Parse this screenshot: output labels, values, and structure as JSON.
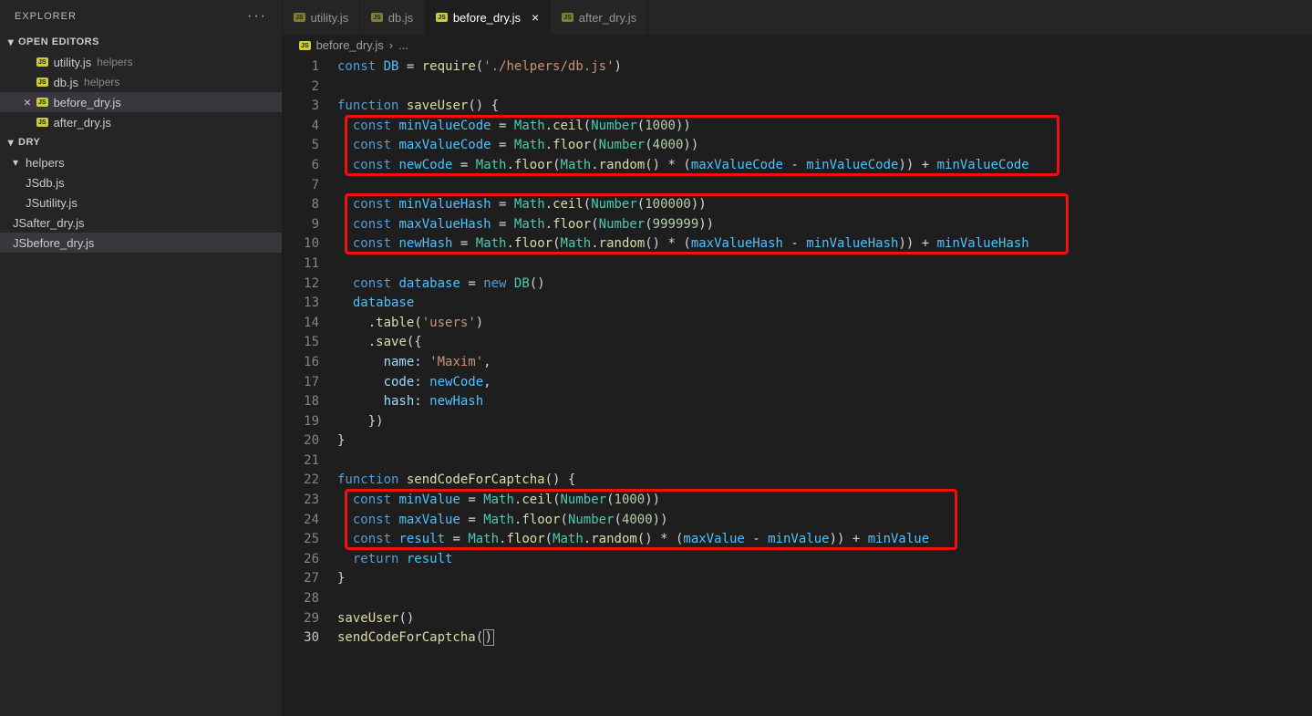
{
  "sidebar": {
    "title": "EXPLORER",
    "sections": {
      "open_editors": {
        "label": "OPEN EDITORS",
        "items": [
          {
            "name": "utility.js",
            "path": "helpers",
            "active": false,
            "showClose": false
          },
          {
            "name": "db.js",
            "path": "helpers",
            "active": false,
            "showClose": false
          },
          {
            "name": "before_dry.js",
            "path": "",
            "active": true,
            "showClose": true
          },
          {
            "name": "after_dry.js",
            "path": "",
            "active": false,
            "showClose": false
          }
        ]
      },
      "project": {
        "label": "DRY",
        "tree": [
          {
            "type": "folder",
            "name": "helpers",
            "depth": 1
          },
          {
            "type": "file",
            "name": "db.js",
            "depth": 2
          },
          {
            "type": "file",
            "name": "utility.js",
            "depth": 2
          },
          {
            "type": "file",
            "name": "after_dry.js",
            "depth": 1
          },
          {
            "type": "file",
            "name": "before_dry.js",
            "depth": 1,
            "active": true
          }
        ]
      }
    }
  },
  "tabs": [
    {
      "name": "utility.js",
      "active": false
    },
    {
      "name": "db.js",
      "active": false
    },
    {
      "name": "before_dry.js",
      "active": true
    },
    {
      "name": "after_dry.js",
      "active": false
    }
  ],
  "breadcrumb": {
    "file": "before_dry.js",
    "sep": "›",
    "more": "..."
  },
  "code": {
    "lines": [
      [
        [
          "kw",
          "const"
        ],
        [
          "plain",
          " "
        ],
        [
          "const",
          "DB"
        ],
        [
          "plain",
          " = "
        ],
        [
          "fn",
          "require"
        ],
        [
          "plain",
          "("
        ],
        [
          "str",
          "'./helpers/db.js'"
        ],
        [
          "plain",
          ")"
        ]
      ],
      [],
      [
        [
          "kw",
          "function"
        ],
        [
          "plain",
          " "
        ],
        [
          "fn",
          "saveUser"
        ],
        [
          "plain",
          "() {"
        ]
      ],
      [
        [
          "plain",
          "  "
        ],
        [
          "kw",
          "const"
        ],
        [
          "plain",
          " "
        ],
        [
          "const",
          "minValueCode"
        ],
        [
          "plain",
          " = "
        ],
        [
          "type",
          "Math"
        ],
        [
          "plain",
          "."
        ],
        [
          "fn",
          "ceil"
        ],
        [
          "plain",
          "("
        ],
        [
          "type",
          "Number"
        ],
        [
          "plain",
          "("
        ],
        [
          "num",
          "1000"
        ],
        [
          "plain",
          "))"
        ]
      ],
      [
        [
          "plain",
          "  "
        ],
        [
          "kw",
          "const"
        ],
        [
          "plain",
          " "
        ],
        [
          "const",
          "maxValueCode"
        ],
        [
          "plain",
          " = "
        ],
        [
          "type",
          "Math"
        ],
        [
          "plain",
          "."
        ],
        [
          "fn",
          "floor"
        ],
        [
          "plain",
          "("
        ],
        [
          "type",
          "Number"
        ],
        [
          "plain",
          "("
        ],
        [
          "num",
          "4000"
        ],
        [
          "plain",
          "))"
        ]
      ],
      [
        [
          "plain",
          "  "
        ],
        [
          "kw",
          "const"
        ],
        [
          "plain",
          " "
        ],
        [
          "const",
          "newCode"
        ],
        [
          "plain",
          " = "
        ],
        [
          "type",
          "Math"
        ],
        [
          "plain",
          "."
        ],
        [
          "fn",
          "floor"
        ],
        [
          "plain",
          "("
        ],
        [
          "type",
          "Math"
        ],
        [
          "plain",
          "."
        ],
        [
          "fn",
          "random"
        ],
        [
          "plain",
          "() * ("
        ],
        [
          "const",
          "maxValueCode"
        ],
        [
          "plain",
          " - "
        ],
        [
          "const",
          "minValueCode"
        ],
        [
          "plain",
          ")) + "
        ],
        [
          "const",
          "minValueCode"
        ]
      ],
      [],
      [
        [
          "plain",
          "  "
        ],
        [
          "kw",
          "const"
        ],
        [
          "plain",
          " "
        ],
        [
          "const",
          "minValueHash"
        ],
        [
          "plain",
          " = "
        ],
        [
          "type",
          "Math"
        ],
        [
          "plain",
          "."
        ],
        [
          "fn",
          "ceil"
        ],
        [
          "plain",
          "("
        ],
        [
          "type",
          "Number"
        ],
        [
          "plain",
          "("
        ],
        [
          "num",
          "100000"
        ],
        [
          "plain",
          "))"
        ]
      ],
      [
        [
          "plain",
          "  "
        ],
        [
          "kw",
          "const"
        ],
        [
          "plain",
          " "
        ],
        [
          "const",
          "maxValueHash"
        ],
        [
          "plain",
          " = "
        ],
        [
          "type",
          "Math"
        ],
        [
          "plain",
          "."
        ],
        [
          "fn",
          "floor"
        ],
        [
          "plain",
          "("
        ],
        [
          "type",
          "Number"
        ],
        [
          "plain",
          "("
        ],
        [
          "num",
          "999999"
        ],
        [
          "plain",
          "))"
        ]
      ],
      [
        [
          "plain",
          "  "
        ],
        [
          "kw",
          "const"
        ],
        [
          "plain",
          " "
        ],
        [
          "const",
          "newHash"
        ],
        [
          "plain",
          " = "
        ],
        [
          "type",
          "Math"
        ],
        [
          "plain",
          "."
        ],
        [
          "fn",
          "floor"
        ],
        [
          "plain",
          "("
        ],
        [
          "type",
          "Math"
        ],
        [
          "plain",
          "."
        ],
        [
          "fn",
          "random"
        ],
        [
          "plain",
          "() * ("
        ],
        [
          "const",
          "maxValueHash"
        ],
        [
          "plain",
          " - "
        ],
        [
          "const",
          "minValueHash"
        ],
        [
          "plain",
          ")) + "
        ],
        [
          "const",
          "minValueHash"
        ]
      ],
      [],
      [
        [
          "plain",
          "  "
        ],
        [
          "kw",
          "const"
        ],
        [
          "plain",
          " "
        ],
        [
          "const",
          "database"
        ],
        [
          "plain",
          " = "
        ],
        [
          "kw",
          "new"
        ],
        [
          "plain",
          " "
        ],
        [
          "type",
          "DB"
        ],
        [
          "plain",
          "()"
        ]
      ],
      [
        [
          "plain",
          "  "
        ],
        [
          "const",
          "database"
        ]
      ],
      [
        [
          "plain",
          "    ."
        ],
        [
          "fn",
          "table"
        ],
        [
          "plain",
          "("
        ],
        [
          "str",
          "'users'"
        ],
        [
          "plain",
          ")"
        ]
      ],
      [
        [
          "plain",
          "    ."
        ],
        [
          "fn",
          "save"
        ],
        [
          "plain",
          "({"
        ]
      ],
      [
        [
          "plain",
          "      "
        ],
        [
          "prop",
          "name"
        ],
        [
          "plain",
          ": "
        ],
        [
          "str",
          "'Maxim'"
        ],
        [
          "plain",
          ","
        ]
      ],
      [
        [
          "plain",
          "      "
        ],
        [
          "prop",
          "code"
        ],
        [
          "plain",
          ": "
        ],
        [
          "const",
          "newCode"
        ],
        [
          "plain",
          ","
        ]
      ],
      [
        [
          "plain",
          "      "
        ],
        [
          "prop",
          "hash"
        ],
        [
          "plain",
          ": "
        ],
        [
          "const",
          "newHash"
        ]
      ],
      [
        [
          "plain",
          "    })"
        ]
      ],
      [
        [
          "plain",
          "}"
        ]
      ],
      [],
      [
        [
          "kw",
          "function"
        ],
        [
          "plain",
          " "
        ],
        [
          "fn",
          "sendCodeForCaptcha"
        ],
        [
          "plain",
          "() {"
        ]
      ],
      [
        [
          "plain",
          "  "
        ],
        [
          "kw",
          "const"
        ],
        [
          "plain",
          " "
        ],
        [
          "const",
          "minValue"
        ],
        [
          "plain",
          " = "
        ],
        [
          "type",
          "Math"
        ],
        [
          "plain",
          "."
        ],
        [
          "fn",
          "ceil"
        ],
        [
          "plain",
          "("
        ],
        [
          "type",
          "Number"
        ],
        [
          "plain",
          "("
        ],
        [
          "num",
          "1000"
        ],
        [
          "plain",
          "))"
        ]
      ],
      [
        [
          "plain",
          "  "
        ],
        [
          "kw",
          "const"
        ],
        [
          "plain",
          " "
        ],
        [
          "const",
          "maxValue"
        ],
        [
          "plain",
          " = "
        ],
        [
          "type",
          "Math"
        ],
        [
          "plain",
          "."
        ],
        [
          "fn",
          "floor"
        ],
        [
          "plain",
          "("
        ],
        [
          "type",
          "Number"
        ],
        [
          "plain",
          "("
        ],
        [
          "num",
          "4000"
        ],
        [
          "plain",
          "))"
        ]
      ],
      [
        [
          "plain",
          "  "
        ],
        [
          "kw",
          "const"
        ],
        [
          "plain",
          " "
        ],
        [
          "const",
          "result"
        ],
        [
          "plain",
          " = "
        ],
        [
          "type",
          "Math"
        ],
        [
          "plain",
          "."
        ],
        [
          "fn",
          "floor"
        ],
        [
          "plain",
          "("
        ],
        [
          "type",
          "Math"
        ],
        [
          "plain",
          "."
        ],
        [
          "fn",
          "random"
        ],
        [
          "plain",
          "() * ("
        ],
        [
          "const",
          "maxValue"
        ],
        [
          "plain",
          " - "
        ],
        [
          "const",
          "minValue"
        ],
        [
          "plain",
          ")) + "
        ],
        [
          "const",
          "minValue"
        ]
      ],
      [
        [
          "plain",
          "  "
        ],
        [
          "kw",
          "return"
        ],
        [
          "plain",
          " "
        ],
        [
          "const",
          "result"
        ]
      ],
      [
        [
          "plain",
          "}"
        ]
      ],
      [],
      [
        [
          "fn",
          "saveUser"
        ],
        [
          "plain",
          "()"
        ]
      ],
      [
        [
          "fn",
          "sendCodeForCaptcha"
        ],
        [
          "plain",
          "("
        ],
        [
          "cursor",
          ")"
        ]
      ]
    ],
    "currentLine": 30,
    "highlights": [
      {
        "startLine": 4,
        "endLine": 6
      },
      {
        "startLine": 8,
        "endLine": 10
      },
      {
        "startLine": 23,
        "endLine": 25
      }
    ]
  }
}
